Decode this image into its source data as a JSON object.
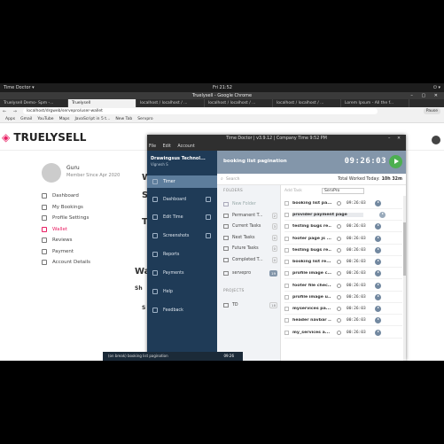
{
  "os": {
    "activities": "Time Doctor ▾",
    "clock": "Fri 21:52",
    "tray": "⏻ ▾"
  },
  "browser": {
    "title": "Truelysell - Google Chrome",
    "tabs": [
      "Truelysell Demo- Spm -...",
      "Truelysell",
      "localhost / localhost / ...",
      "localhost / localhost / ...",
      "localhost / localhost / ...",
      "Lorem Ipsum - All the f..."
    ],
    "url": "localhost/drgweb/servepro/user-wallet",
    "profile": "Pause",
    "bookmarks": [
      "Apps",
      "Gmail",
      "YouTube",
      "Maps",
      "JavaScript in 5 t...",
      "New Tab",
      "Servpro"
    ]
  },
  "site": {
    "logo_main": "TRUELY",
    "logo_accent": "SELL",
    "user": {
      "name": "Guru",
      "since": "Member Since Apr 2020"
    },
    "menu": [
      "Dashboard",
      "My Bookings",
      "Profile Settings",
      "Wallet",
      "Reviews",
      "Payment",
      "Account Details"
    ],
    "active_menu": "Wallet",
    "headings": {
      "w1": "W",
      "s1": "S",
      "t1": "T",
      "wa": "Wa",
      "sh": "Sh",
      "s2": "S"
    }
  },
  "timedoctor": {
    "title": "Time Doctor | v3.9.12 | Company Time 9:52 PM",
    "menu": [
      "File",
      "Edit",
      "Account"
    ],
    "company": "Drawingsus Technol...",
    "user": "Vignesh S",
    "nav": [
      "Timer",
      "Dashboard",
      "Edit Time",
      "Screenshots",
      "Reports",
      "Payments",
      "Help",
      "Feedback"
    ],
    "current_task": "booking list pagination",
    "timer": "09:26:03",
    "search_placeholder": "Search",
    "worked_label": "Total Worked Today:",
    "worked_value": "10h 32m",
    "folders_head": "FOLDERS",
    "new_folder": "New Folder",
    "folders": [
      {
        "name": "Permanent T...",
        "count": "2"
      },
      {
        "name": "Current Tasks",
        "count": "3"
      },
      {
        "name": "Next Tasks",
        "count": "0"
      },
      {
        "name": "Future Tasks",
        "count": "0"
      },
      {
        "name": "Completed T...",
        "count": "0"
      },
      {
        "name": "servepro",
        "count": "19"
      }
    ],
    "projects_head": "PROJECTS",
    "projects": [
      {
        "name": "TD",
        "count": "18"
      }
    ],
    "add_task": "Add Task",
    "project_select": "ServPro",
    "tasks": [
      {
        "name": "booking list pa...",
        "time": "09:26:03"
      },
      {
        "name": "provider payment page",
        "time": ""
      },
      {
        "name": "testing bugs re...",
        "time": "00:26:03"
      },
      {
        "name": "footer page js ...",
        "time": "00:26:03"
      },
      {
        "name": "testing bugs re...",
        "time": "00:26:03"
      },
      {
        "name": "booking list re...",
        "time": "00:26:03"
      },
      {
        "name": "profile image c...",
        "time": "00:26:03"
      },
      {
        "name": "footer file chec...",
        "time": "00:26:03"
      },
      {
        "name": "profile image u...",
        "time": "00:26:03"
      },
      {
        "name": "myservices pa...",
        "time": "00:26:03"
      },
      {
        "name": "header navbar ...",
        "time": "00:26:03"
      },
      {
        "name": "my_services a...",
        "time": "00:26:03"
      }
    ],
    "widget_task": "(on break) booking list pagination",
    "widget_time": "09:26",
    "footer": "⇆"
  }
}
